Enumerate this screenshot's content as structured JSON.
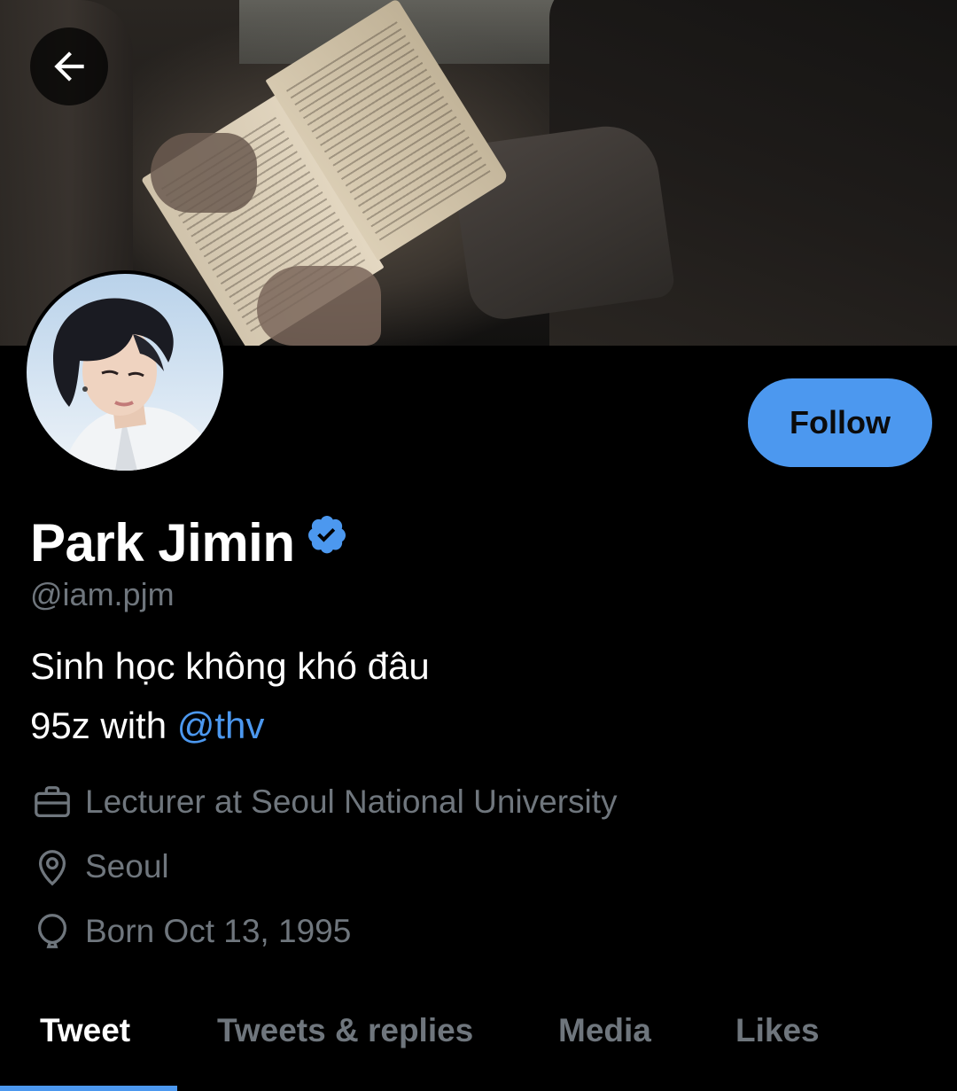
{
  "header": {
    "back_icon": "arrow-left-icon",
    "follow_label": "Follow"
  },
  "profile": {
    "name": "Park Jimin",
    "verified": true,
    "handle": "@iam.pjm",
    "bio_line1": "Sinh học không khó đâu",
    "bio_line2_prefix": "95z with ",
    "bio_line2_mention": "@thv",
    "work": "Lecturer at Seoul National University",
    "location": "Seoul",
    "birthday": "Born Oct 13, 1995"
  },
  "tabs": [
    {
      "label": "Tweet",
      "active": true
    },
    {
      "label": "Tweets & replies",
      "active": false
    },
    {
      "label": "Media",
      "active": false
    },
    {
      "label": "Likes",
      "active": false
    }
  ],
  "colors": {
    "accent": "#4c98ef",
    "background": "#000000",
    "secondary_text": "#6f767d"
  }
}
